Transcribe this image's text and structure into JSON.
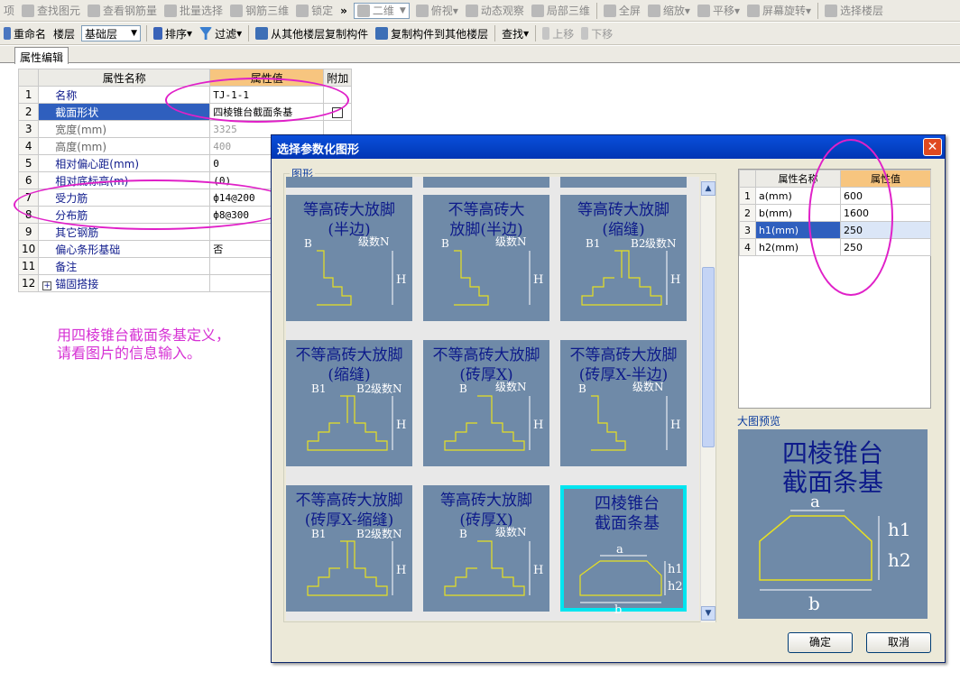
{
  "toolbar1": [
    "项",
    "查找图元",
    "查看钢筋量",
    "批量选择",
    "钢筋三维",
    "锁定",
    "»",
    "二维",
    "俯视",
    "动态观察",
    "局部三维",
    "全屏",
    "缩放",
    "平移",
    "屏幕旋转",
    "选择楼层"
  ],
  "toolbar2": {
    "rename": "重命名",
    "floor_label": "楼层",
    "floor_value": "基础层",
    "sort": "排序",
    "filter": "过滤",
    "copy_from": "从其他楼层复制构件",
    "copy_to": "复制构件到其他楼层",
    "find": "查找",
    "up": "上移",
    "down": "下移"
  },
  "tab": "属性编辑",
  "prop_table": {
    "headers": [
      "属性名称",
      "属性值",
      "附加"
    ],
    "rows": [
      {
        "n": "1",
        "name": "名称",
        "value": "TJ-1-1",
        "dim": false
      },
      {
        "n": "2",
        "name": "截面形状",
        "value": "四棱锥台截面条基",
        "dim": false
      },
      {
        "n": "3",
        "name": "宽度(mm)",
        "value": "3325",
        "dim": true
      },
      {
        "n": "4",
        "name": "高度(mm)",
        "value": "400",
        "dim": true
      },
      {
        "n": "5",
        "name": "相对偏心距(mm)",
        "value": "0",
        "dim": false
      },
      {
        "n": "6",
        "name": "相对底标高(m)",
        "value": "(0)",
        "dim": false
      },
      {
        "n": "7",
        "name": "受力筋",
        "value": "ф14@200",
        "dim": false
      },
      {
        "n": "8",
        "name": "分布筋",
        "value": "ф8@300",
        "dim": false
      },
      {
        "n": "9",
        "name": "其它钢筋",
        "value": "",
        "dim": false
      },
      {
        "n": "10",
        "name": "偏心条形基础",
        "value": "否",
        "dim": false
      },
      {
        "n": "11",
        "name": "备注",
        "value": "",
        "dim": false
      },
      {
        "n": "12",
        "name": "锚固搭接",
        "value": "",
        "dim": false
      }
    ]
  },
  "note": [
    "用四棱锥台截面条基定义，",
    "请看图片的信息输入。"
  ],
  "dialog": {
    "title": "选择参数化图形",
    "close": "✕",
    "group_label": "图形",
    "preview_label": "大图预览",
    "ok": "确定",
    "cancel": "取消",
    "params": {
      "headers": [
        "属性名称",
        "属性值"
      ],
      "rows": [
        {
          "n": "1",
          "name": "a(mm)",
          "value": "600"
        },
        {
          "n": "2",
          "name": "b(mm)",
          "value": "1600"
        },
        {
          "n": "3",
          "name": "h1(mm)",
          "value": "250"
        },
        {
          "n": "4",
          "name": "h2(mm)",
          "value": "250"
        }
      ]
    },
    "shapes": [
      {
        "title": [
          "等高砖大放脚",
          "(半边)"
        ],
        "labels": [
          "B",
          "级数N",
          "H"
        ]
      },
      {
        "title": [
          "不等高砖大",
          "放脚(半边)"
        ],
        "labels": [
          "B",
          "级数N",
          "H"
        ]
      },
      {
        "title": [
          "等高砖大放脚",
          "(缩缝)"
        ],
        "labels": [
          "B1",
          "B2",
          "级数N",
          "H"
        ]
      },
      {
        "title": [
          "不等高砖大放脚",
          "(缩缝)"
        ],
        "labels": [
          "B1",
          "B2",
          "级数N",
          "H"
        ]
      },
      {
        "title": [
          "不等高砖大放脚",
          "(砖厚X)"
        ],
        "labels": [
          "B",
          "级数N",
          "H"
        ]
      },
      {
        "title": [
          "不等高砖大放脚",
          "(砖厚X-半边)"
        ],
        "labels": [
          "B",
          "级数N",
          "H"
        ]
      },
      {
        "title": [
          "不等高砖大放脚",
          "(砖厚X-缩缝)"
        ],
        "labels": [
          "B1",
          "B2",
          "级数N",
          "H"
        ]
      },
      {
        "title": [
          "等高砖大放脚",
          "(砖厚X)"
        ],
        "labels": [
          "B",
          "级数N",
          "H"
        ]
      },
      {
        "title": [
          "四棱锥台",
          "截面条基"
        ],
        "labels": [
          "a",
          "h1",
          "h2",
          "b"
        ]
      }
    ],
    "preview": {
      "title": [
        "四棱锥台",
        "截面条基"
      ],
      "labels": [
        "a",
        "h1",
        "h2",
        "b"
      ]
    }
  },
  "colors": {
    "dialog_title": "#0543c7",
    "selected_row": "#2f5fbe",
    "header_value": "#f7c57f",
    "annotation": "#e020c8",
    "shape_bg": "#6f8aa8"
  }
}
